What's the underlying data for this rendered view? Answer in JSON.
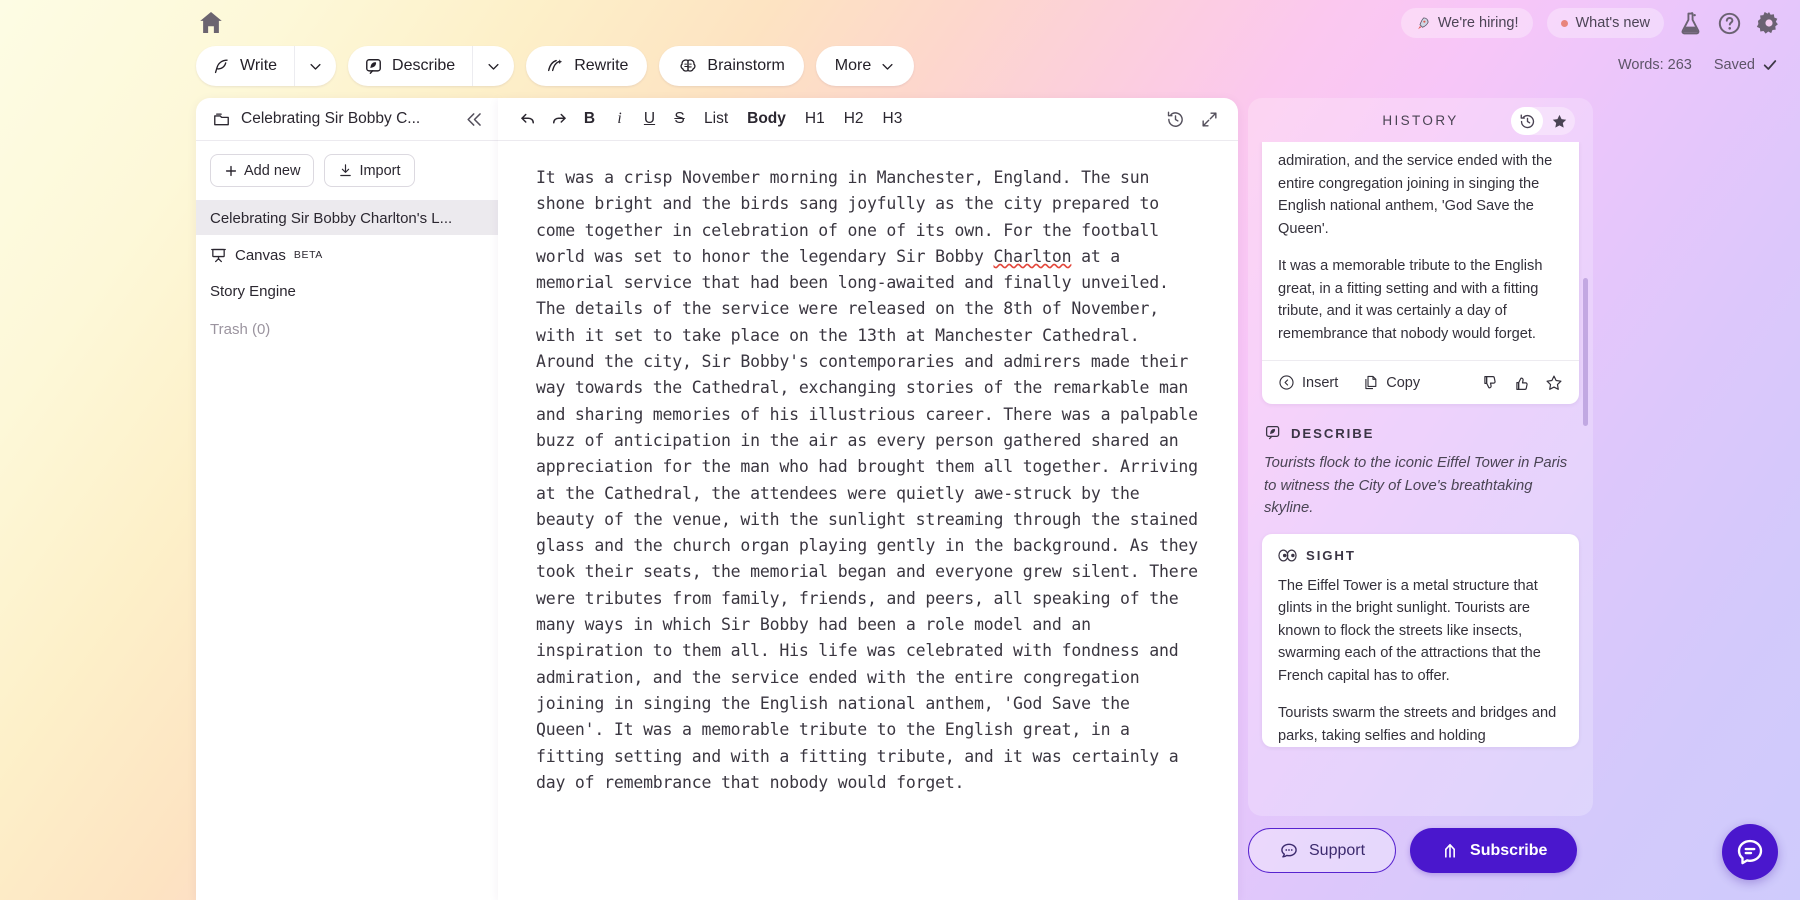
{
  "topbar": {
    "home_icon": "home-icon",
    "tools": [
      {
        "label": "Write",
        "icon": "quill-icon",
        "has_caret": true
      },
      {
        "label": "Describe",
        "icon": "describe-icon",
        "has_caret": true
      },
      {
        "label": "Rewrite",
        "icon": "rewrite-icon",
        "has_caret": false
      },
      {
        "label": "Brainstorm",
        "icon": "brain-icon",
        "has_caret": false
      },
      {
        "label": "More",
        "icon": "",
        "has_caret": true
      }
    ],
    "chips": [
      {
        "label": "We're hiring!",
        "icon": "rocket-icon"
      },
      {
        "label": "What's new",
        "icon": "dot-icon"
      }
    ],
    "icons": [
      "flask-icon",
      "help-icon",
      "gear-icon"
    ],
    "word_count": "Words: 263",
    "save_status": "Saved"
  },
  "sidebar": {
    "project_title": "Celebrating Sir Bobby C...",
    "collapse_icon": "chevrons-left-icon",
    "add_new_label": "Add new",
    "import_label": "Import",
    "items": [
      {
        "label": "Celebrating Sir Bobby Charlton's L...",
        "selected": true,
        "icon": ""
      },
      {
        "label": "Canvas",
        "badge": "BETA",
        "icon": "canvas-icon"
      },
      {
        "label": "Story Engine",
        "icon": ""
      },
      {
        "label": "Trash (0)",
        "muted": true,
        "icon": ""
      }
    ]
  },
  "editor": {
    "format_buttons": [
      {
        "label": "undo-icon",
        "type": "icon"
      },
      {
        "label": "redo-icon",
        "type": "icon"
      },
      {
        "label": "B",
        "type": "bold"
      },
      {
        "label": "i",
        "type": "ital"
      },
      {
        "label": "U",
        "type": "undl"
      },
      {
        "label": "S",
        "type": "strk"
      },
      {
        "label": "List",
        "type": "word"
      },
      {
        "label": "Body",
        "type": "word active"
      },
      {
        "label": "H1",
        "type": "word"
      },
      {
        "label": "H2",
        "type": "word"
      },
      {
        "label": "H3",
        "type": "word"
      }
    ],
    "right_icons": [
      "history-icon",
      "expand-icon"
    ],
    "document_text_part1": "It was a crisp November morning in Manchester, England. The sun shone bright and the birds sang joyfully as the city prepared to come together in celebration of one of its own. For the football world was set to honor the legendary Sir Bobby ",
    "document_misspelled_word": "Charlton",
    "document_text_part2": " at a memorial service that had been long-awaited and finally unveiled. The details of the service were released on the 8th of November, with it set to take place on the 13th at Manchester Cathedral. Around the city, Sir Bobby's contemporaries and admirers made their way towards the Cathedral, exchanging stories of the remarkable man and sharing memories of his illustrious career. There was a palpable buzz of anticipation in the air as every person gathered shared an appreciation for the man who had brought them all together. Arriving at the Cathedral, the attendees were quietly awe-struck by the beauty of the venue, with the sunlight streaming through the stained glass and the church organ playing gently in the background. As they took their seats, the memorial began and everyone grew silent. There were tributes from family, friends, and peers, all speaking of the many ways in which Sir Bobby had been a role model and an inspiration to them all. His life was celebrated with fondness and admiration, and the service ended with the entire congregation joining in singing the English national anthem, 'God Save the Queen'. It was a memorable tribute to the English great, in a fitting setting and with a fitting tribute, and it was certainly a day of remembrance that nobody would forget."
  },
  "rightpanel": {
    "header_title": "HISTORY",
    "toggles": [
      {
        "icon": "history-icon",
        "active": true
      },
      {
        "icon": "star-filled-icon",
        "active": false
      }
    ],
    "history_card": {
      "paragraph_1": "admiration, and the service ended with the entire congregation joining in singing the English national anthem, 'God Save the Queen'.",
      "paragraph_2": "It was a memorable tribute to the English great, in a fitting setting and with a fitting tribute, and it was certainly a day of remembrance that nobody would forget.",
      "insert_label": "Insert",
      "copy_label": "Copy",
      "icons": [
        "insert-icon",
        "copy-icon",
        "thumbs-down-icon",
        "thumbs-up-icon",
        "star-outline-icon"
      ]
    },
    "describe_section": {
      "title": "DESCRIBE",
      "icon": "describe-icon",
      "prompt": "Tourists flock to the iconic Eiffel Tower in Paris to witness the City of Love's breathtaking skyline."
    },
    "sight_card": {
      "title": "SIGHT",
      "icon": "eyes-icon",
      "paragraph_1": "The Eiffel Tower is a metal structure that glints in the bright sunlight. Tourists are known to flock the streets like insects, swarming each of the attractions that the French capital has to offer.",
      "paragraph_2": "Tourists swarm the streets and bridges and parks, taking selfies and holding"
    }
  },
  "bottom": {
    "support_label": "Support",
    "support_icon": "chat-icon",
    "subscribe_label": "Subscribe",
    "subscribe_icon": "arrow-up-icon",
    "chat_fab_icon": "chat-bubble-icon"
  },
  "colors": {
    "accent_purple": "#4a17cd",
    "support_border": "#5723cf",
    "spellcheck_red": "#e2453a",
    "selected_row": "#eceaee"
  }
}
